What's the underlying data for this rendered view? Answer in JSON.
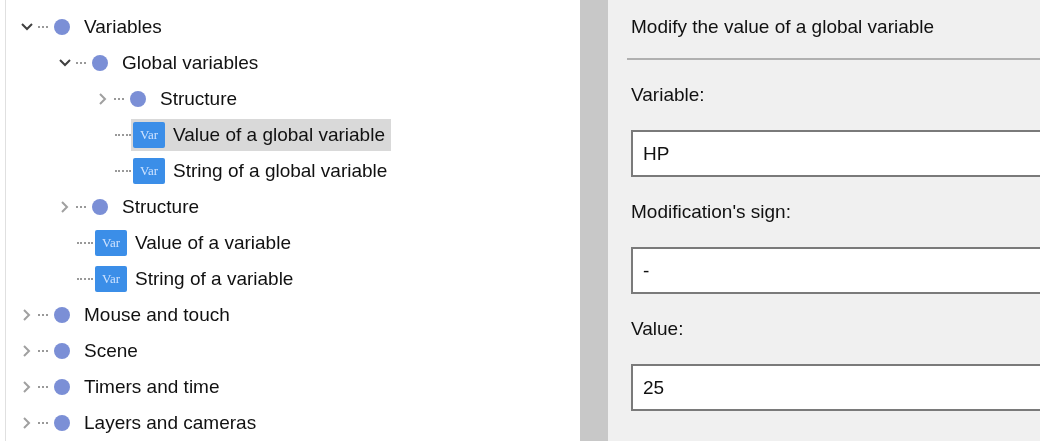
{
  "tree": [
    {
      "kind": "folder",
      "label": "Variables",
      "expanded": true,
      "selected": false,
      "children": [
        {
          "kind": "folder",
          "label": "Global variables",
          "expanded": true,
          "selected": false,
          "children": [
            {
              "kind": "folder",
              "label": "Structure",
              "expanded": false,
              "selected": false
            },
            {
              "kind": "item",
              "icon_label": "Var",
              "label": "Value of a global variable",
              "selected": true
            },
            {
              "kind": "item",
              "icon_label": "Var",
              "label": "String of a global variable",
              "selected": false
            }
          ]
        },
        {
          "kind": "folder",
          "label": "Structure",
          "expanded": false,
          "selected": false
        },
        {
          "kind": "item",
          "icon_label": "Var",
          "label": "Value of a variable",
          "selected": false
        },
        {
          "kind": "item",
          "icon_label": "Var",
          "label": "String of a variable",
          "selected": false
        }
      ]
    },
    {
      "kind": "folder",
      "label": "Mouse and touch",
      "expanded": false,
      "selected": false
    },
    {
      "kind": "folder",
      "label": "Scene",
      "expanded": false,
      "selected": false
    },
    {
      "kind": "folder",
      "label": "Timers and time",
      "expanded": false,
      "selected": false
    },
    {
      "kind": "folder",
      "label": "Layers and cameras",
      "expanded": false,
      "selected": false
    }
  ],
  "panel": {
    "title": "Modify the value of a global variable",
    "fields": [
      {
        "label": "Variable:",
        "value": "HP"
      },
      {
        "label": "Modification's sign:",
        "value": "-"
      },
      {
        "label": "Value:",
        "value": "25"
      }
    ]
  }
}
